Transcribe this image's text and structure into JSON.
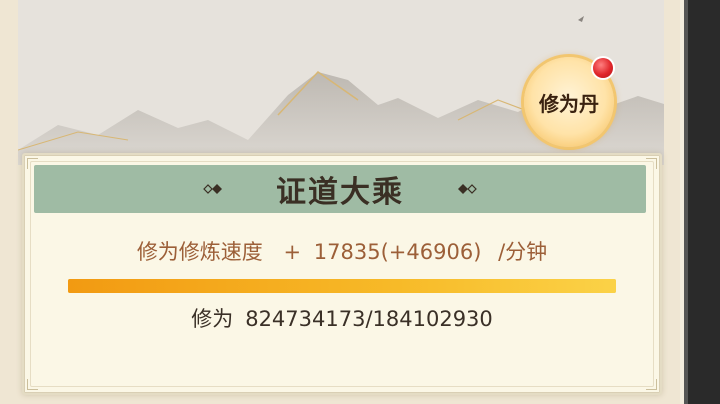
{
  "pill": {
    "label": "修为丹"
  },
  "panel": {
    "title": "证道大乘",
    "rate": {
      "label": "修为修炼速度",
      "plus": "+",
      "base": "17835",
      "bonus": "(+46906)",
      "unit": "/分钟"
    },
    "progress": {
      "fraction": 1.0
    },
    "exp": {
      "label": "修为",
      "value": "824734173/184102930"
    }
  },
  "colors": {
    "title_bar": "#9fbba4",
    "rate_text": "#9c5f38",
    "progress": "#f7ba28",
    "notify_dot": "#e0262a"
  }
}
